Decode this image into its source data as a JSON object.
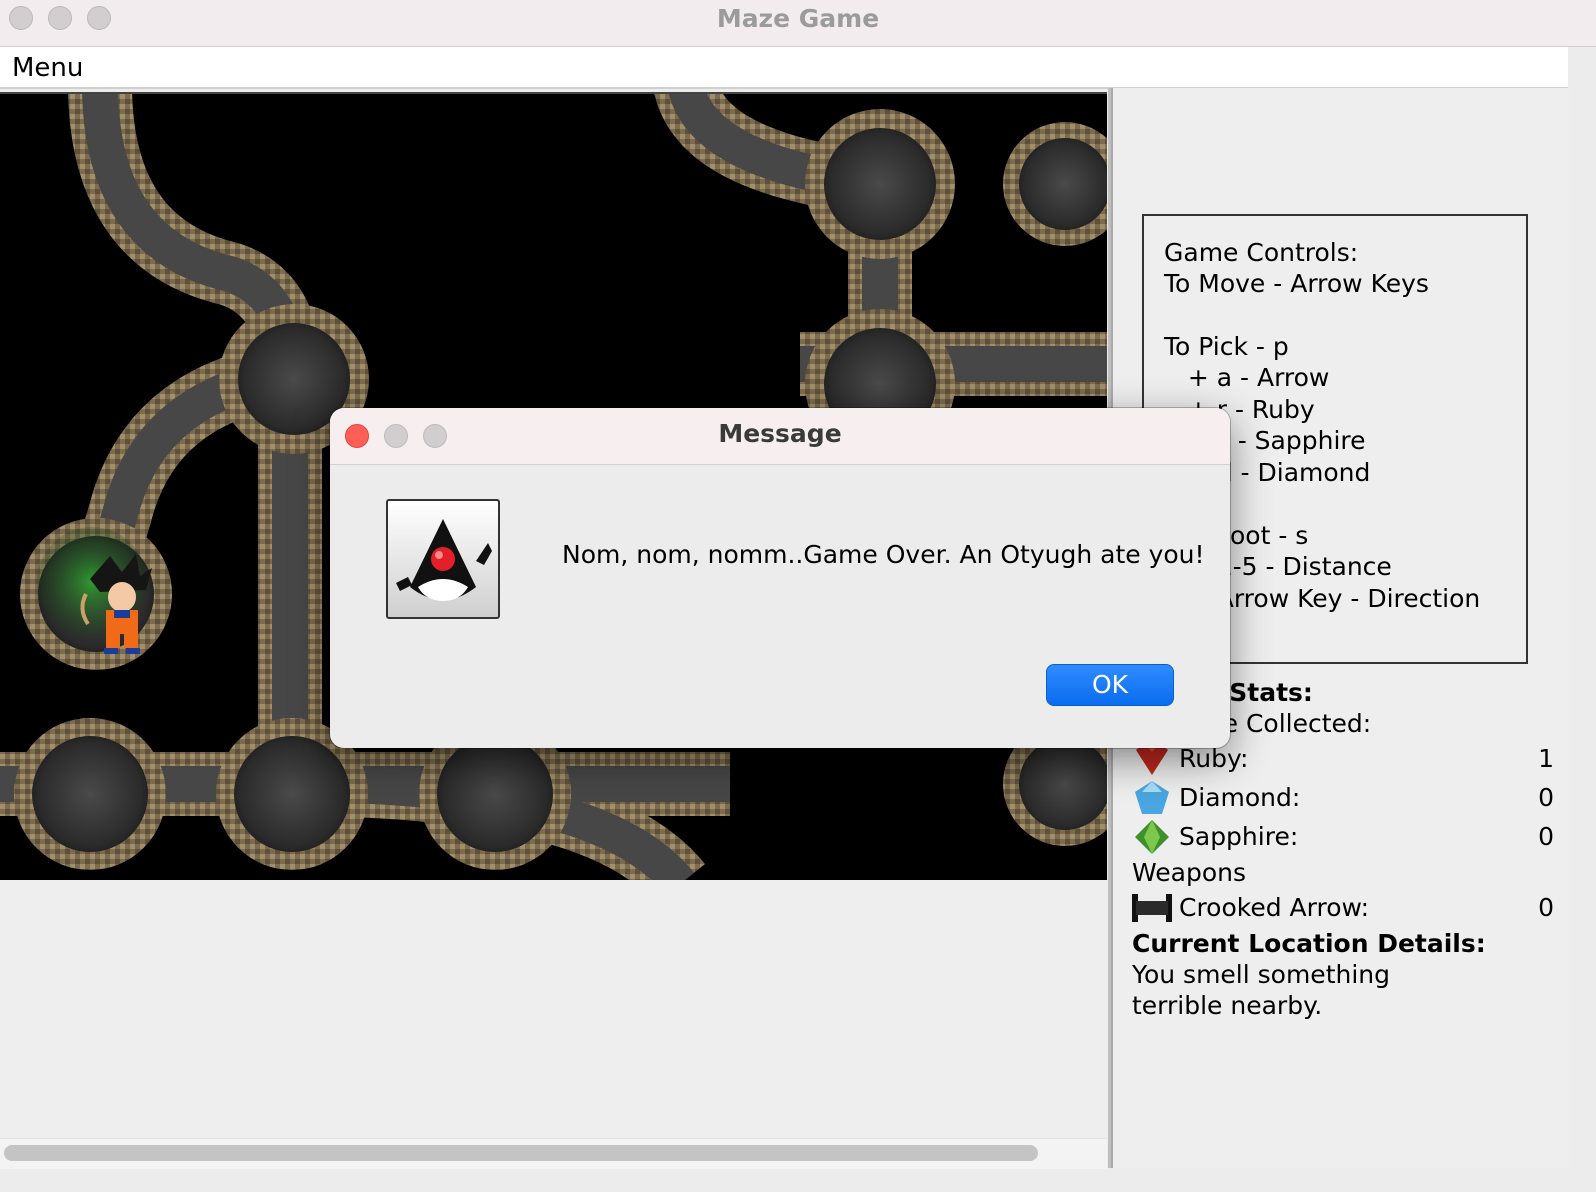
{
  "window": {
    "title": "Maze Game"
  },
  "menubar": {
    "menu_label": "Menu"
  },
  "controls": {
    "lines": [
      "Game Controls:",
      "To Move - Arrow Keys",
      "",
      "To Pick - p",
      "   + a - Arrow",
      "   + r - Ruby",
      "   + s - Sapphire",
      "   + d - Diamond",
      "",
      "To Shoot - s",
      "   + 1-5 - Distance",
      "   + Arrow Key - Direction"
    ]
  },
  "stats": {
    "heading": "Player Stats:",
    "treasure_heading": "Treasure Collected:",
    "ruby_label": "Ruby:",
    "ruby_value": "1",
    "diamond_label": "Diamond:",
    "diamond_value": "0",
    "sapphire_label": "Sapphire:",
    "sapphire_value": "0",
    "weapons_heading": "Weapons",
    "arrow_label": "Crooked Arrow:",
    "arrow_value": "0",
    "location_heading": "Current Location Details:",
    "location_line1": "You smell something",
    "location_line2": "terrible nearby."
  },
  "dialog": {
    "title": "Message",
    "message": "Nom, nom, nomm..Game Over. An Otyugh ate you!",
    "ok_label": "OK",
    "icon": "java-duke-icon"
  },
  "colors": {
    "tunnel_wall": "#8a7a5c",
    "tunnel_floor": "#4a4a4a",
    "ok_button": "#0a6cf0"
  }
}
